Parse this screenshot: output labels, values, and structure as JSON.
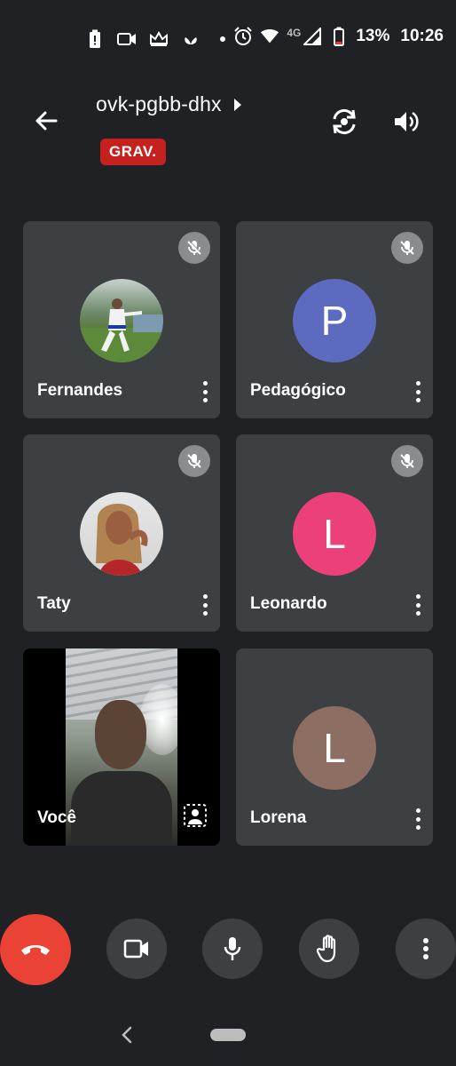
{
  "status_bar": {
    "battery_percent": "13%",
    "time": "10:26",
    "network": "4G",
    "icons": [
      "battery-alert-icon",
      "video-camera-icon",
      "crown-icon",
      "sprout-icon",
      "dot-icon",
      "alarm-icon",
      "wifi-icon",
      "signal-icon",
      "battery-icon"
    ]
  },
  "header": {
    "meeting_code": "ovk-pgbb-dhx",
    "recording_badge": "GRAV.",
    "recording_color": "#c5221f",
    "icons": [
      "back-arrow-icon",
      "caret-right-icon",
      "switch-camera-icon",
      "speaker-icon"
    ]
  },
  "participants": [
    {
      "name": "Fernandes",
      "avatar": "photo",
      "muted": true
    },
    {
      "name": "Pedagógico",
      "avatar_letter": "P",
      "avatar_color": "#5c6bc0",
      "muted": true
    },
    {
      "name": "Taty",
      "avatar": "photo",
      "muted": true
    },
    {
      "name": "Leonardo",
      "avatar_letter": "L",
      "avatar_color": "#ec407a",
      "muted": true
    },
    {
      "name": "Você",
      "avatar": "live-video",
      "muted": false,
      "presenting": true
    },
    {
      "name": "Lorena",
      "avatar_letter": "L",
      "avatar_color": "#8d6e63",
      "muted": false
    }
  ],
  "controls": {
    "end_call_color": "#ea4335",
    "buttons": [
      "end-call-icon",
      "camera-icon",
      "microphone-icon",
      "raise-hand-icon",
      "more-options-icon"
    ]
  }
}
